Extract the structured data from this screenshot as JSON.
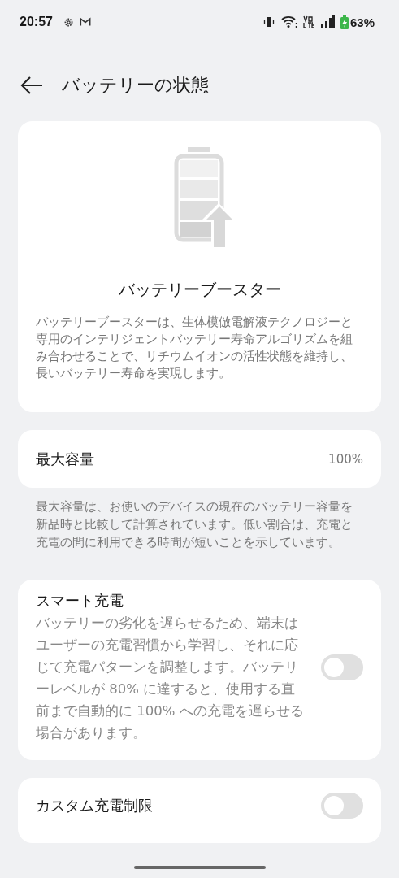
{
  "status_bar": {
    "time": "20:57",
    "battery": "63%"
  },
  "header": {
    "title": "バッテリーの状態"
  },
  "booster_card": {
    "title": "バッテリーブースター",
    "description": "バッテリーブースターは、生体模倣電解液テクノロジーと専用のインテリジェントバッテリー寿命アルゴリズムを組み合わせることで、リチウムイオンの活性状態を維持し、長いバッテリー寿命を実現します。"
  },
  "capacity": {
    "label": "最大容量",
    "value": "100%",
    "note": "最大容量は、お使いのデバイスの現在のバッテリー容量を新品時と比較して計算されています。低い割合は、充電と充電の間に利用できる時間が短いことを示しています。"
  },
  "toggles": [
    {
      "label": "スマート充電",
      "description": "バッテリーの劣化を遅らせるため、端末はユーザーの充電習慣から学習し、それに応じて充電パターンを調整します。バッテリーレベルが 80% に達すると、使用する直前まで自動的に 100% への充電を遅らせる場合があります。",
      "on": false
    },
    {
      "label": "カスタム充電制限",
      "on": false
    }
  ]
}
